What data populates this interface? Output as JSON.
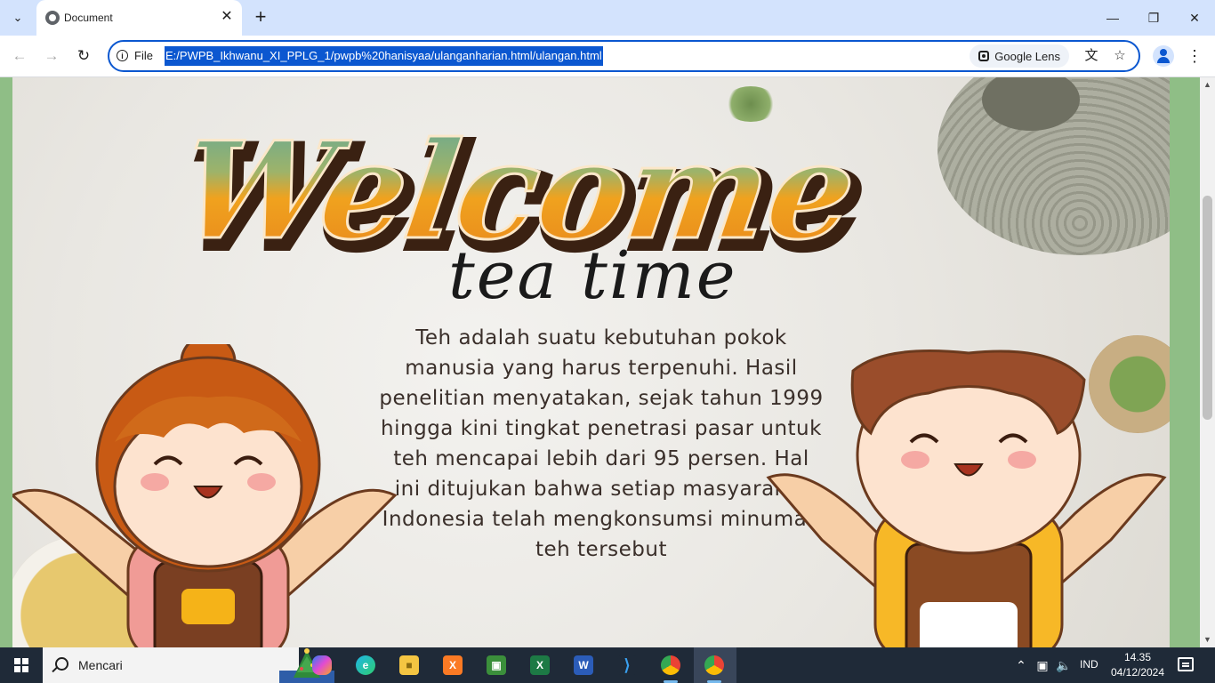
{
  "browser": {
    "tab_title": "Document",
    "omnibox": {
      "scheme_label": "File",
      "url": "E:/PWPB_Ikhwanu_XI_PPLG_1/pwpb%20hanisyaa/ulanganharian.html/ulangan.html",
      "lens_label": "Google Lens"
    }
  },
  "page": {
    "heading": "Welcome",
    "subheading": "tea time",
    "body_text": "Teh adalah suatu kebutuhan pokok manusia yang harus terpenuhi. Hasil penelitian menyatakan, sejak tahun 1999 hingga kini tingkat penetrasi pasar untuk teh mencapai lebih dari 95 persen. Hal ini ditujukan bahwa setiap masyarakat Indonesia telah mengkonsumsi minuman teh tersebut"
  },
  "taskbar": {
    "search_label": "Mencari",
    "apps": [
      "copilot-icon",
      "edge-icon",
      "file-explorer-icon",
      "xampp-icon",
      "minecraft-icon",
      "excel-icon",
      "word-icon",
      "vscode-icon",
      "chrome-profile-icon",
      "chrome-icon"
    ],
    "language": "IND",
    "time": "14.35",
    "date": "04/12/2024"
  },
  "colors": {
    "tabstrip": "#d3e3fd",
    "accent": "#0b57d0",
    "page_border": "#8fbe86",
    "taskbar": "#1f2a38"
  }
}
